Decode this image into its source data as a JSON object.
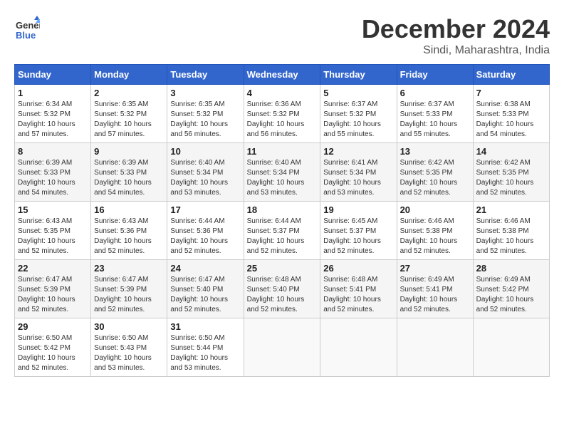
{
  "header": {
    "logo_line1": "General",
    "logo_line2": "Blue",
    "month": "December 2024",
    "location": "Sindi, Maharashtra, India"
  },
  "weekdays": [
    "Sunday",
    "Monday",
    "Tuesday",
    "Wednesday",
    "Thursday",
    "Friday",
    "Saturday"
  ],
  "weeks": [
    [
      {
        "day": "1",
        "info": "Sunrise: 6:34 AM\nSunset: 5:32 PM\nDaylight: 10 hours\nand 57 minutes."
      },
      {
        "day": "2",
        "info": "Sunrise: 6:35 AM\nSunset: 5:32 PM\nDaylight: 10 hours\nand 57 minutes."
      },
      {
        "day": "3",
        "info": "Sunrise: 6:35 AM\nSunset: 5:32 PM\nDaylight: 10 hours\nand 56 minutes."
      },
      {
        "day": "4",
        "info": "Sunrise: 6:36 AM\nSunset: 5:32 PM\nDaylight: 10 hours\nand 56 minutes."
      },
      {
        "day": "5",
        "info": "Sunrise: 6:37 AM\nSunset: 5:32 PM\nDaylight: 10 hours\nand 55 minutes."
      },
      {
        "day": "6",
        "info": "Sunrise: 6:37 AM\nSunset: 5:33 PM\nDaylight: 10 hours\nand 55 minutes."
      },
      {
        "day": "7",
        "info": "Sunrise: 6:38 AM\nSunset: 5:33 PM\nDaylight: 10 hours\nand 54 minutes."
      }
    ],
    [
      {
        "day": "8",
        "info": "Sunrise: 6:39 AM\nSunset: 5:33 PM\nDaylight: 10 hours\nand 54 minutes."
      },
      {
        "day": "9",
        "info": "Sunrise: 6:39 AM\nSunset: 5:33 PM\nDaylight: 10 hours\nand 54 minutes."
      },
      {
        "day": "10",
        "info": "Sunrise: 6:40 AM\nSunset: 5:34 PM\nDaylight: 10 hours\nand 53 minutes."
      },
      {
        "day": "11",
        "info": "Sunrise: 6:40 AM\nSunset: 5:34 PM\nDaylight: 10 hours\nand 53 minutes."
      },
      {
        "day": "12",
        "info": "Sunrise: 6:41 AM\nSunset: 5:34 PM\nDaylight: 10 hours\nand 53 minutes."
      },
      {
        "day": "13",
        "info": "Sunrise: 6:42 AM\nSunset: 5:35 PM\nDaylight: 10 hours\nand 52 minutes."
      },
      {
        "day": "14",
        "info": "Sunrise: 6:42 AM\nSunset: 5:35 PM\nDaylight: 10 hours\nand 52 minutes."
      }
    ],
    [
      {
        "day": "15",
        "info": "Sunrise: 6:43 AM\nSunset: 5:35 PM\nDaylight: 10 hours\nand 52 minutes."
      },
      {
        "day": "16",
        "info": "Sunrise: 6:43 AM\nSunset: 5:36 PM\nDaylight: 10 hours\nand 52 minutes."
      },
      {
        "day": "17",
        "info": "Sunrise: 6:44 AM\nSunset: 5:36 PM\nDaylight: 10 hours\nand 52 minutes."
      },
      {
        "day": "18",
        "info": "Sunrise: 6:44 AM\nSunset: 5:37 PM\nDaylight: 10 hours\nand 52 minutes."
      },
      {
        "day": "19",
        "info": "Sunrise: 6:45 AM\nSunset: 5:37 PM\nDaylight: 10 hours\nand 52 minutes."
      },
      {
        "day": "20",
        "info": "Sunrise: 6:46 AM\nSunset: 5:38 PM\nDaylight: 10 hours\nand 52 minutes."
      },
      {
        "day": "21",
        "info": "Sunrise: 6:46 AM\nSunset: 5:38 PM\nDaylight: 10 hours\nand 52 minutes."
      }
    ],
    [
      {
        "day": "22",
        "info": "Sunrise: 6:47 AM\nSunset: 5:39 PM\nDaylight: 10 hours\nand 52 minutes."
      },
      {
        "day": "23",
        "info": "Sunrise: 6:47 AM\nSunset: 5:39 PM\nDaylight: 10 hours\nand 52 minutes."
      },
      {
        "day": "24",
        "info": "Sunrise: 6:47 AM\nSunset: 5:40 PM\nDaylight: 10 hours\nand 52 minutes."
      },
      {
        "day": "25",
        "info": "Sunrise: 6:48 AM\nSunset: 5:40 PM\nDaylight: 10 hours\nand 52 minutes."
      },
      {
        "day": "26",
        "info": "Sunrise: 6:48 AM\nSunset: 5:41 PM\nDaylight: 10 hours\nand 52 minutes."
      },
      {
        "day": "27",
        "info": "Sunrise: 6:49 AM\nSunset: 5:41 PM\nDaylight: 10 hours\nand 52 minutes."
      },
      {
        "day": "28",
        "info": "Sunrise: 6:49 AM\nSunset: 5:42 PM\nDaylight: 10 hours\nand 52 minutes."
      }
    ],
    [
      {
        "day": "29",
        "info": "Sunrise: 6:50 AM\nSunset: 5:42 PM\nDaylight: 10 hours\nand 52 minutes."
      },
      {
        "day": "30",
        "info": "Sunrise: 6:50 AM\nSunset: 5:43 PM\nDaylight: 10 hours\nand 53 minutes."
      },
      {
        "day": "31",
        "info": "Sunrise: 6:50 AM\nSunset: 5:44 PM\nDaylight: 10 hours\nand 53 minutes."
      },
      {
        "day": "",
        "info": ""
      },
      {
        "day": "",
        "info": ""
      },
      {
        "day": "",
        "info": ""
      },
      {
        "day": "",
        "info": ""
      }
    ]
  ]
}
